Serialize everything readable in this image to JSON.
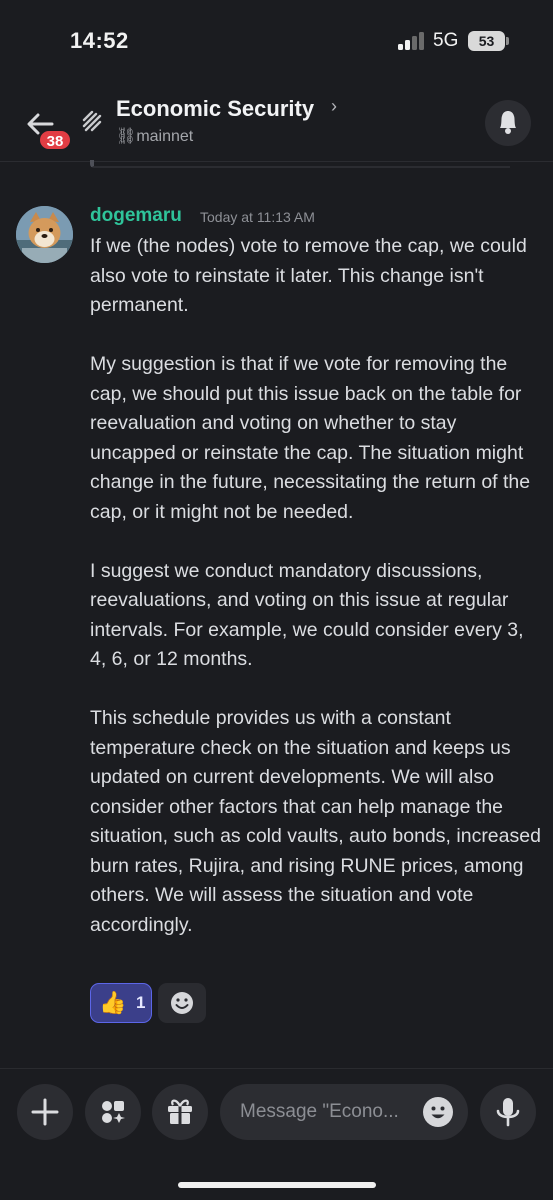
{
  "status_bar": {
    "time": "14:52",
    "network": "5G",
    "battery": "53"
  },
  "header": {
    "unread_count": "38",
    "channel_name": "Economic Security",
    "chevron": "›",
    "subtitle": "⛓mainnet",
    "icons": [
      "back-arrow-icon",
      "thread-icon",
      "bell-icon"
    ]
  },
  "message": {
    "author": "dogemaru",
    "timestamp": "Today at 11:13 AM",
    "paragraphs": [
      "If we (the nodes) vote to remove the cap, we could also vote to reinstate it later. This change isn't permanent.",
      "My suggestion is that if we vote for removing the cap, we should put this issue back on the table for reevaluation and voting on whether to stay uncapped or reinstate the cap. The situation might change in the future, necessitating the return of the cap, or it might not be needed.",
      "I suggest we conduct mandatory discussions, reevaluations, and voting on this issue at regular intervals. For example, we could consider every 3, 4, 6, or 12 months.",
      "This schedule provides us with a constant temperature check on the situation and keeps us updated on current developments. We will also consider other factors that can help manage the situation, such as cold vaults, auto bonds, increased burn rates, Rujira, and rising RUNE prices, among others. We will assess the situation and vote accordingly."
    ],
    "reactions": [
      {
        "emoji": "👍",
        "count": "1"
      }
    ]
  },
  "composer": {
    "placeholder": "Message \"Econo...",
    "icons": [
      "plus-icon",
      "apps-icon",
      "gift-icon",
      "emoji-icon",
      "microphone-icon"
    ]
  },
  "colors": {
    "background": "#1b1c20",
    "author": "#2fc49a",
    "badge": "#e23d44",
    "reaction_bg": "#3b3f8a",
    "reaction_border": "#5c66e8"
  }
}
